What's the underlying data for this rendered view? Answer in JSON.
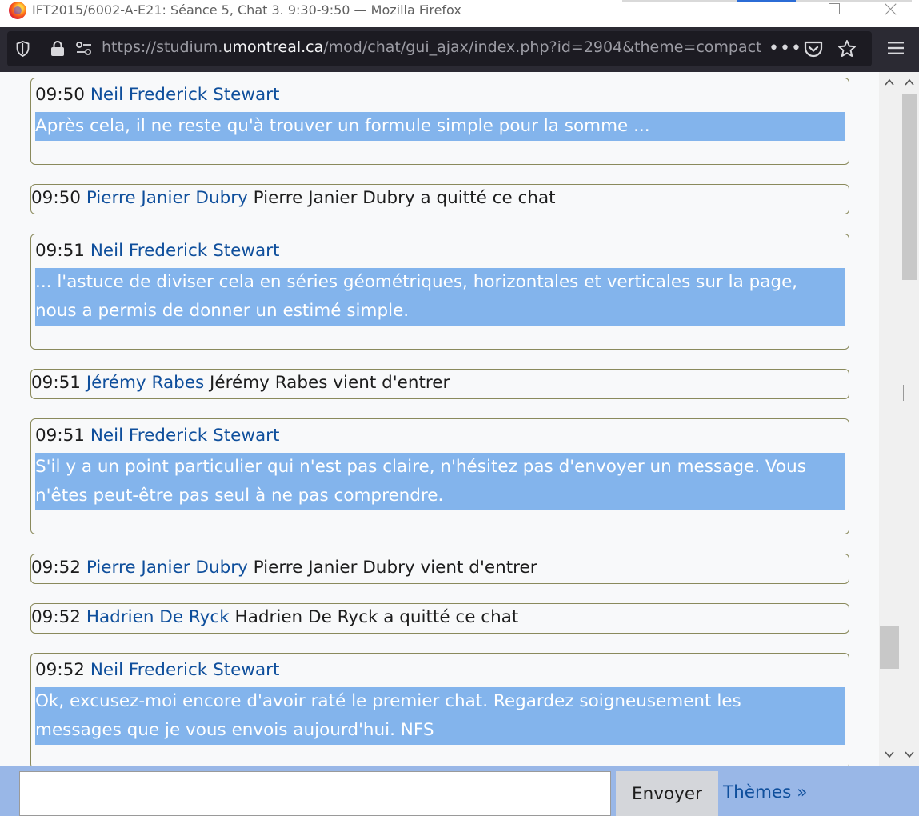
{
  "window": {
    "title": "IFT2015/6002-A-E21: Séance 5, Chat 3. 9:30-9:50 — Mozilla Firefox"
  },
  "toolbar": {
    "url_prefix": "https://studium.",
    "url_domain": "umontreal.ca",
    "url_suffix": "/mod/chat/gui_ajax/index.php?id=2904&theme=compact",
    "more_glyph": "•••"
  },
  "chat": {
    "messages": [
      {
        "time": "09:50",
        "user": "Neil Frederick Stewart",
        "lines": [
          "Après cela, il ne reste qu'à trouver un formule simple pour la somme ..."
        ]
      },
      {
        "time": "09:50",
        "user": "Pierre Janier Dubry",
        "event": "Pierre Janier Dubry a quitté ce chat"
      },
      {
        "time": "09:51",
        "user": "Neil Frederick Stewart",
        "lines": [
          "... l'astuce de diviser cela en séries géométriques, horizontales et verticales sur la page,",
          "nous a permis de donner un estimé simple."
        ]
      },
      {
        "time": "09:51",
        "user": "Jérémy Rabes",
        "event": "Jérémy Rabes vient d'entrer"
      },
      {
        "time": "09:51",
        "user": "Neil Frederick Stewart",
        "lines": [
          "S'il y a un point particulier qui n'est pas claire, n'hésitez pas d'envoyer un message. Vous",
          "n'êtes peut-être pas seul à ne pas comprendre."
        ]
      },
      {
        "time": "09:52",
        "user": "Pierre Janier Dubry",
        "event": "Pierre Janier Dubry vient d'entrer"
      },
      {
        "time": "09:52",
        "user": "Hadrien De Ryck",
        "event": "Hadrien De Ryck a quitté ce chat"
      },
      {
        "time": "09:52",
        "user": "Neil Frederick Stewart",
        "lines": [
          "Ok, excusez-moi encore d'avoir raté le premier chat. Regardez soigneusement les",
          "messages que je vous envois aujourd'hui. NFS"
        ]
      }
    ]
  },
  "input": {
    "value": "",
    "send_label": "Envoyer",
    "themes_label": "Thèmes »"
  },
  "colors": {
    "user_link": "#0f4f9c",
    "message_highlight": "#83b4ec",
    "input_bar": "#99b7e7",
    "border": "#8a8a5c"
  }
}
